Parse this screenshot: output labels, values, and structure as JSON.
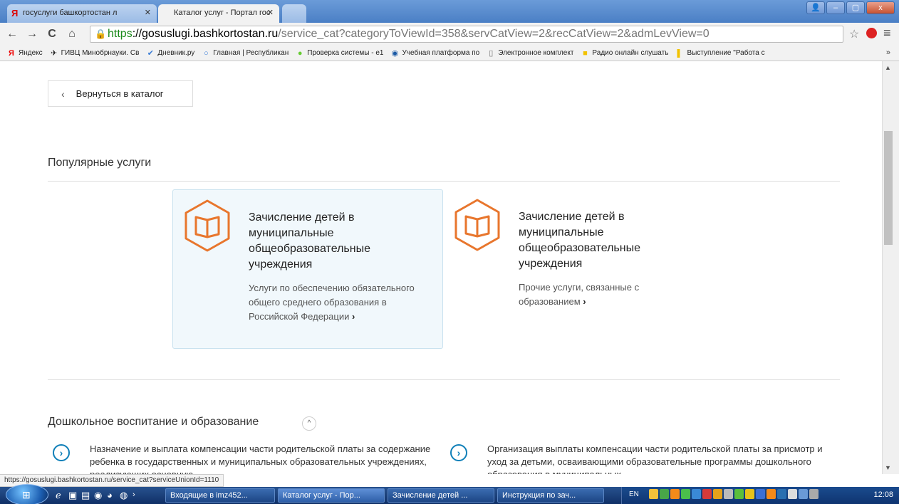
{
  "browser": {
    "tabs": [
      {
        "label": "госуслуги башкортостан л",
        "favicon": "Я",
        "active": false
      },
      {
        "label": "Каталог услуг - Портал гос",
        "active": true
      }
    ],
    "window_controls": {
      "min": "–",
      "max": "▢",
      "close": "x",
      "user": "👤"
    },
    "nav": {
      "back": "←",
      "forward": "→",
      "reload": "C",
      "home": "⌂"
    },
    "url": {
      "scheme": "https",
      "host": "://gosuslugi.bashkortostan.ru",
      "path": "/service_cat?categoryToViewId=358&servCatView=2&recCatView=2&admLevView=0"
    },
    "bookmarks": [
      {
        "label": "Яндекс",
        "icon": "Я",
        "color": "#e00"
      },
      {
        "label": "ГИВЦ Минобрнауки. Св",
        "icon": "✈",
        "color": "#333"
      },
      {
        "label": "Дневник.ру",
        "icon": "✔",
        "color": "#3a7dd6"
      },
      {
        "label": "Главная | Республикан",
        "icon": "○",
        "color": "#3a7dd6"
      },
      {
        "label": "Проверка системы - е1",
        "icon": "●",
        "color": "#6c3"
      },
      {
        "label": "Учебная платформа по",
        "icon": "◉",
        "color": "#1b5aa5"
      },
      {
        "label": "Электронное комплект",
        "icon": "▯",
        "color": "#777"
      },
      {
        "label": "Радио онлайн слушать",
        "icon": "■",
        "color": "#f2c200"
      },
      {
        "label": "Выступление \"Работа с",
        "icon": "▌",
        "color": "#f2c200"
      }
    ],
    "bookmarks_more": "»",
    "status_url": "https://gosuslugi.bashkortostan.ru/service_cat?serviceUnionId=1110"
  },
  "page": {
    "back_button": "Вернуться в каталог",
    "popular_title": "Популярные услуги",
    "cards": [
      {
        "title": "Зачисление детей в муниципальные общеобразовательные учреждения",
        "desc": "Услуги по обеспечению обязательного общего среднего образования в Российской Федерации",
        "more": "›"
      },
      {
        "title": "Зачисление детей в муниципальные общеобразовательные учреждения",
        "desc": "Прочие услуги, связанные с образованием",
        "more": "›"
      }
    ],
    "section2_title": "Дошкольное воспитание и образование",
    "collapse_icon": "^",
    "services": [
      {
        "text": "Назначение и выплата компенсации части родительской платы за содержание ребенка в государственных и муниципальных образовательных учреждениях, реализующих основную"
      },
      {
        "text": "Организация выплаты компенсации части родительской платы за присмотр и уход за детьми, осваивающими образовательные программы дошкольного образования в муниципальных"
      }
    ]
  },
  "taskbar": {
    "tasks": [
      {
        "label": "Входящие в imz452..."
      },
      {
        "label": "Каталог услуг - Пор...",
        "active": true
      },
      {
        "label": "Зачисление детей ..."
      },
      {
        "label": "Инструкция по зач..."
      }
    ],
    "lang": "EN",
    "time": "12:08",
    "arrow": "›"
  },
  "colors": {
    "accent": "#e8762d",
    "link": "#0e7fb8"
  }
}
